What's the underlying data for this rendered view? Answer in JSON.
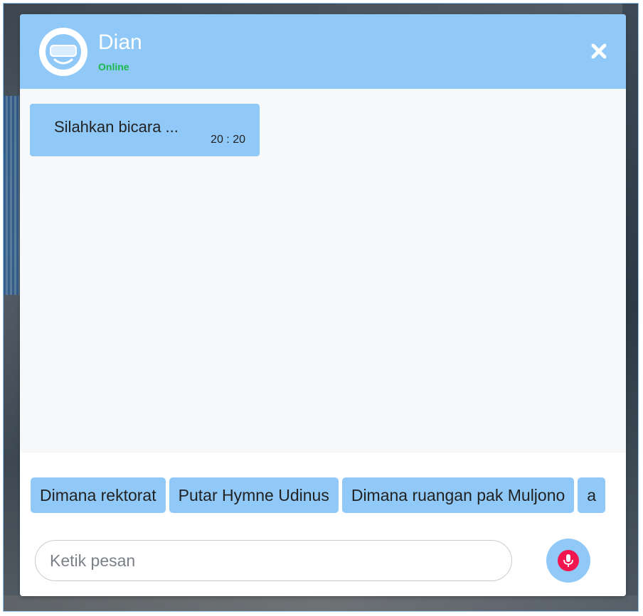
{
  "header": {
    "agent_name": "Dian",
    "status": "Online",
    "avatar_icon": "vr-headset-avatar-icon",
    "close_icon": "close-icon"
  },
  "messages": [
    {
      "text": "Silahkan bicara ...",
      "time": "20 : 20"
    }
  ],
  "suggestions": [
    "Dimana rektorat",
    "Putar Hymne Udinus",
    "Dimana ruangan pak Muljono",
    "a"
  ],
  "composer": {
    "placeholder": "Ketik pesan",
    "value": "",
    "mic_icon": "microphone-icon"
  },
  "colors": {
    "accent": "#90c9f8",
    "status_online": "#1db74d",
    "mic": "#f2164e",
    "background": "#f7f8fa"
  }
}
